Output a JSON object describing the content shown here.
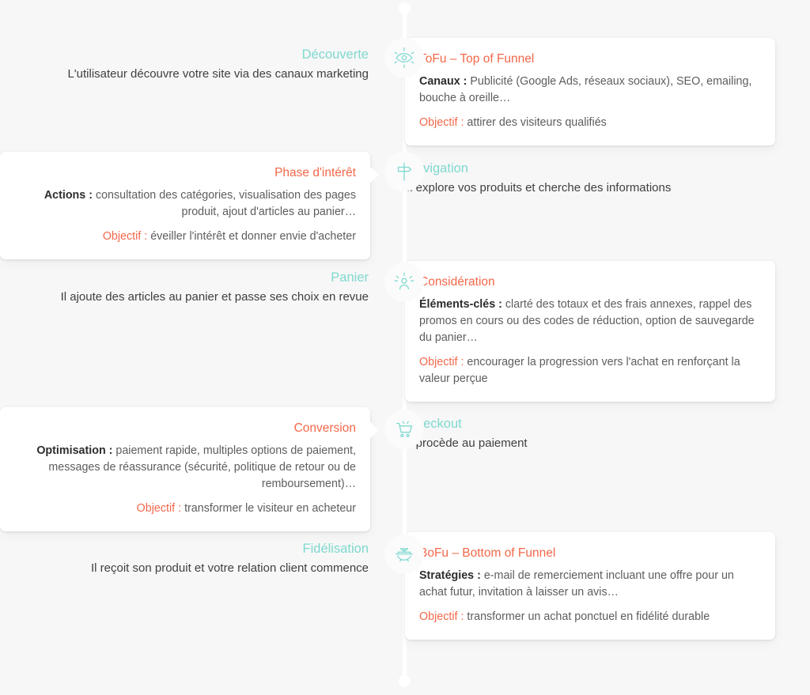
{
  "colors": {
    "background": "#f7f7f7",
    "accent_teal": "#7fd9cf",
    "accent_orange": "#f2684a",
    "card_background": "#ffffff",
    "body_text": "#5d5d5d",
    "strong_text": "#2d2d2d",
    "timeline_line": "#ffffff"
  },
  "timeline": {
    "steps": [
      {
        "icon": "eye-discovery-icon",
        "stage": {
          "title": "Découverte",
          "description": "L'utilisateur découvre votre site via des canaux marketing",
          "side": "left"
        },
        "card": {
          "side": "right",
          "title": "ToFu – Top of Funnel",
          "paragraphs": [
            {
              "lead": "Canaux :",
              "lead_style": "strong",
              "text": " Publicité (Google Ads, réseaux sociaux), SEO, emailing, bouche à oreille…"
            },
            {
              "lead": "Objectif :",
              "lead_style": "objective",
              "text": " attirer des visiteurs qualifiés"
            }
          ]
        }
      },
      {
        "icon": "signpost-navigation-icon",
        "stage": {
          "title": "Navigation",
          "description": "Il explore vos produits et cherche des informations",
          "side": "right"
        },
        "card": {
          "side": "left",
          "title": "Phase d'intérêt",
          "paragraphs": [
            {
              "lead": "Actions :",
              "lead_style": "strong",
              "text": " consultation des catégories, visualisation des pages produit, ajout d'articles au panier…"
            },
            {
              "lead": "Objectif :",
              "lead_style": "objective",
              "text": " éveiller l'intérêt et donner envie d'acheter"
            }
          ]
        }
      },
      {
        "icon": "user-consideration-icon",
        "stage": {
          "title": "Panier",
          "description": "Il ajoute des articles au panier et passe ses choix en revue",
          "side": "left"
        },
        "card": {
          "side": "right",
          "title": "Considération",
          "paragraphs": [
            {
              "lead": "Éléments-clés :",
              "lead_style": "strong",
              "text": " clarté des totaux et des frais annexes, rappel des promos en cours ou des codes de réduction, option de sauvegarde du panier…"
            },
            {
              "lead": "Objectif :",
              "lead_style": "objective",
              "text": " encourager la progression vers l'achat en renforçant la valeur perçue"
            }
          ]
        }
      },
      {
        "icon": "shopping-cart-icon",
        "stage": {
          "title": "Checkout",
          "description": "Il procède au paiement",
          "side": "right"
        },
        "card": {
          "side": "left",
          "title": "Conversion",
          "paragraphs": [
            {
              "lead": "Optimisation :",
              "lead_style": "strong",
              "text": " paiement rapide, multiples options de paiement, messages de réassurance (sécurité, politique de retour ou de remboursement)…"
            },
            {
              "lead": "Objectif :",
              "lead_style": "objective",
              "text": " transformer le visiteur en acheteur"
            }
          ]
        }
      },
      {
        "icon": "caring-hands-loyalty-icon",
        "stage": {
          "title": "Fidélisation",
          "description": "Il reçoit son produit et votre relation client commence",
          "side": "left"
        },
        "card": {
          "side": "right",
          "title": "BoFu – Bottom of Funnel",
          "paragraphs": [
            {
              "lead": "Stratégies :",
              "lead_style": "strong",
              "text": " e-mail de remerciement incluant une offre pour un achat futur, invitation à laisser un avis…"
            },
            {
              "lead": "Objectif :",
              "lead_style": "objective",
              "text": " transformer un achat ponctuel en fidélité durable"
            }
          ]
        }
      }
    ]
  }
}
